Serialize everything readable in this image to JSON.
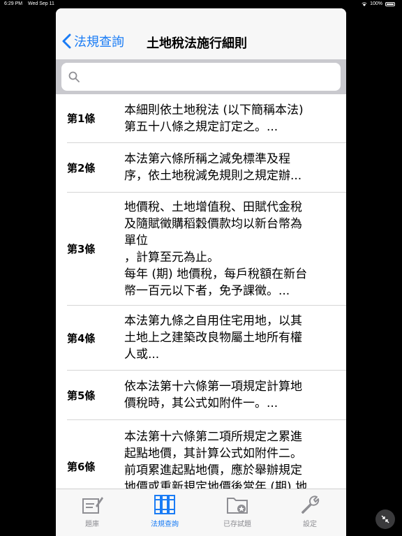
{
  "status_bar": {
    "time": "6:29 PM",
    "date": "Wed Sep 11",
    "battery": "100%"
  },
  "navbar": {
    "back_label": "法規查詢",
    "title": "土地稅法施行細則"
  },
  "search": {
    "placeholder": ""
  },
  "articles": [
    {
      "num": "第1條",
      "text": "本細則依土地稅法 (以下簡稱本法)\n第五十八條之規定訂定之。..."
    },
    {
      "num": "第2條",
      "text": "本法第六條所稱之減免標準及程\n序，依土地稅減免規則之規定辦..."
    },
    {
      "num": "第3條",
      "text": "地價稅、土地增值稅、田賦代金稅\n及隨賦徵購稻穀價款均以新台幣為\n單位\n，計算至元為止。\n每年 (期) 地價稅，每戶稅額在新台\n幣一百元以下者，免予課徵。..."
    },
    {
      "num": "第4條",
      "text": "本法第九條之自用住宅用地，以其\n土地上之建築改良物屬土地所有權\n人或..."
    },
    {
      "num": "第5條",
      "text": "依本法第十六條第一項規定計算地\n價稅時，其公式如附件一。..."
    },
    {
      "num": "第6條",
      "text": "本法第十六條第二項所規定之累進\n起點地價，其計算公式如附件二。\n前項累進起點地價，應於舉辦規定\n地價或重新規定地價後當年 (期) 地"
    }
  ],
  "tabbar": [
    {
      "label": "題庫",
      "icon": "notepad-pencil-icon",
      "active": false
    },
    {
      "label": "法規查詢",
      "icon": "book-binders-icon",
      "active": true
    },
    {
      "label": "已存試題",
      "icon": "folder-star-icon",
      "active": false
    },
    {
      "label": "設定",
      "icon": "wrench-icon",
      "active": false
    }
  ],
  "colors": {
    "accent": "#1a7cf5",
    "inactive": "#8e8e93",
    "background": "#000000"
  }
}
